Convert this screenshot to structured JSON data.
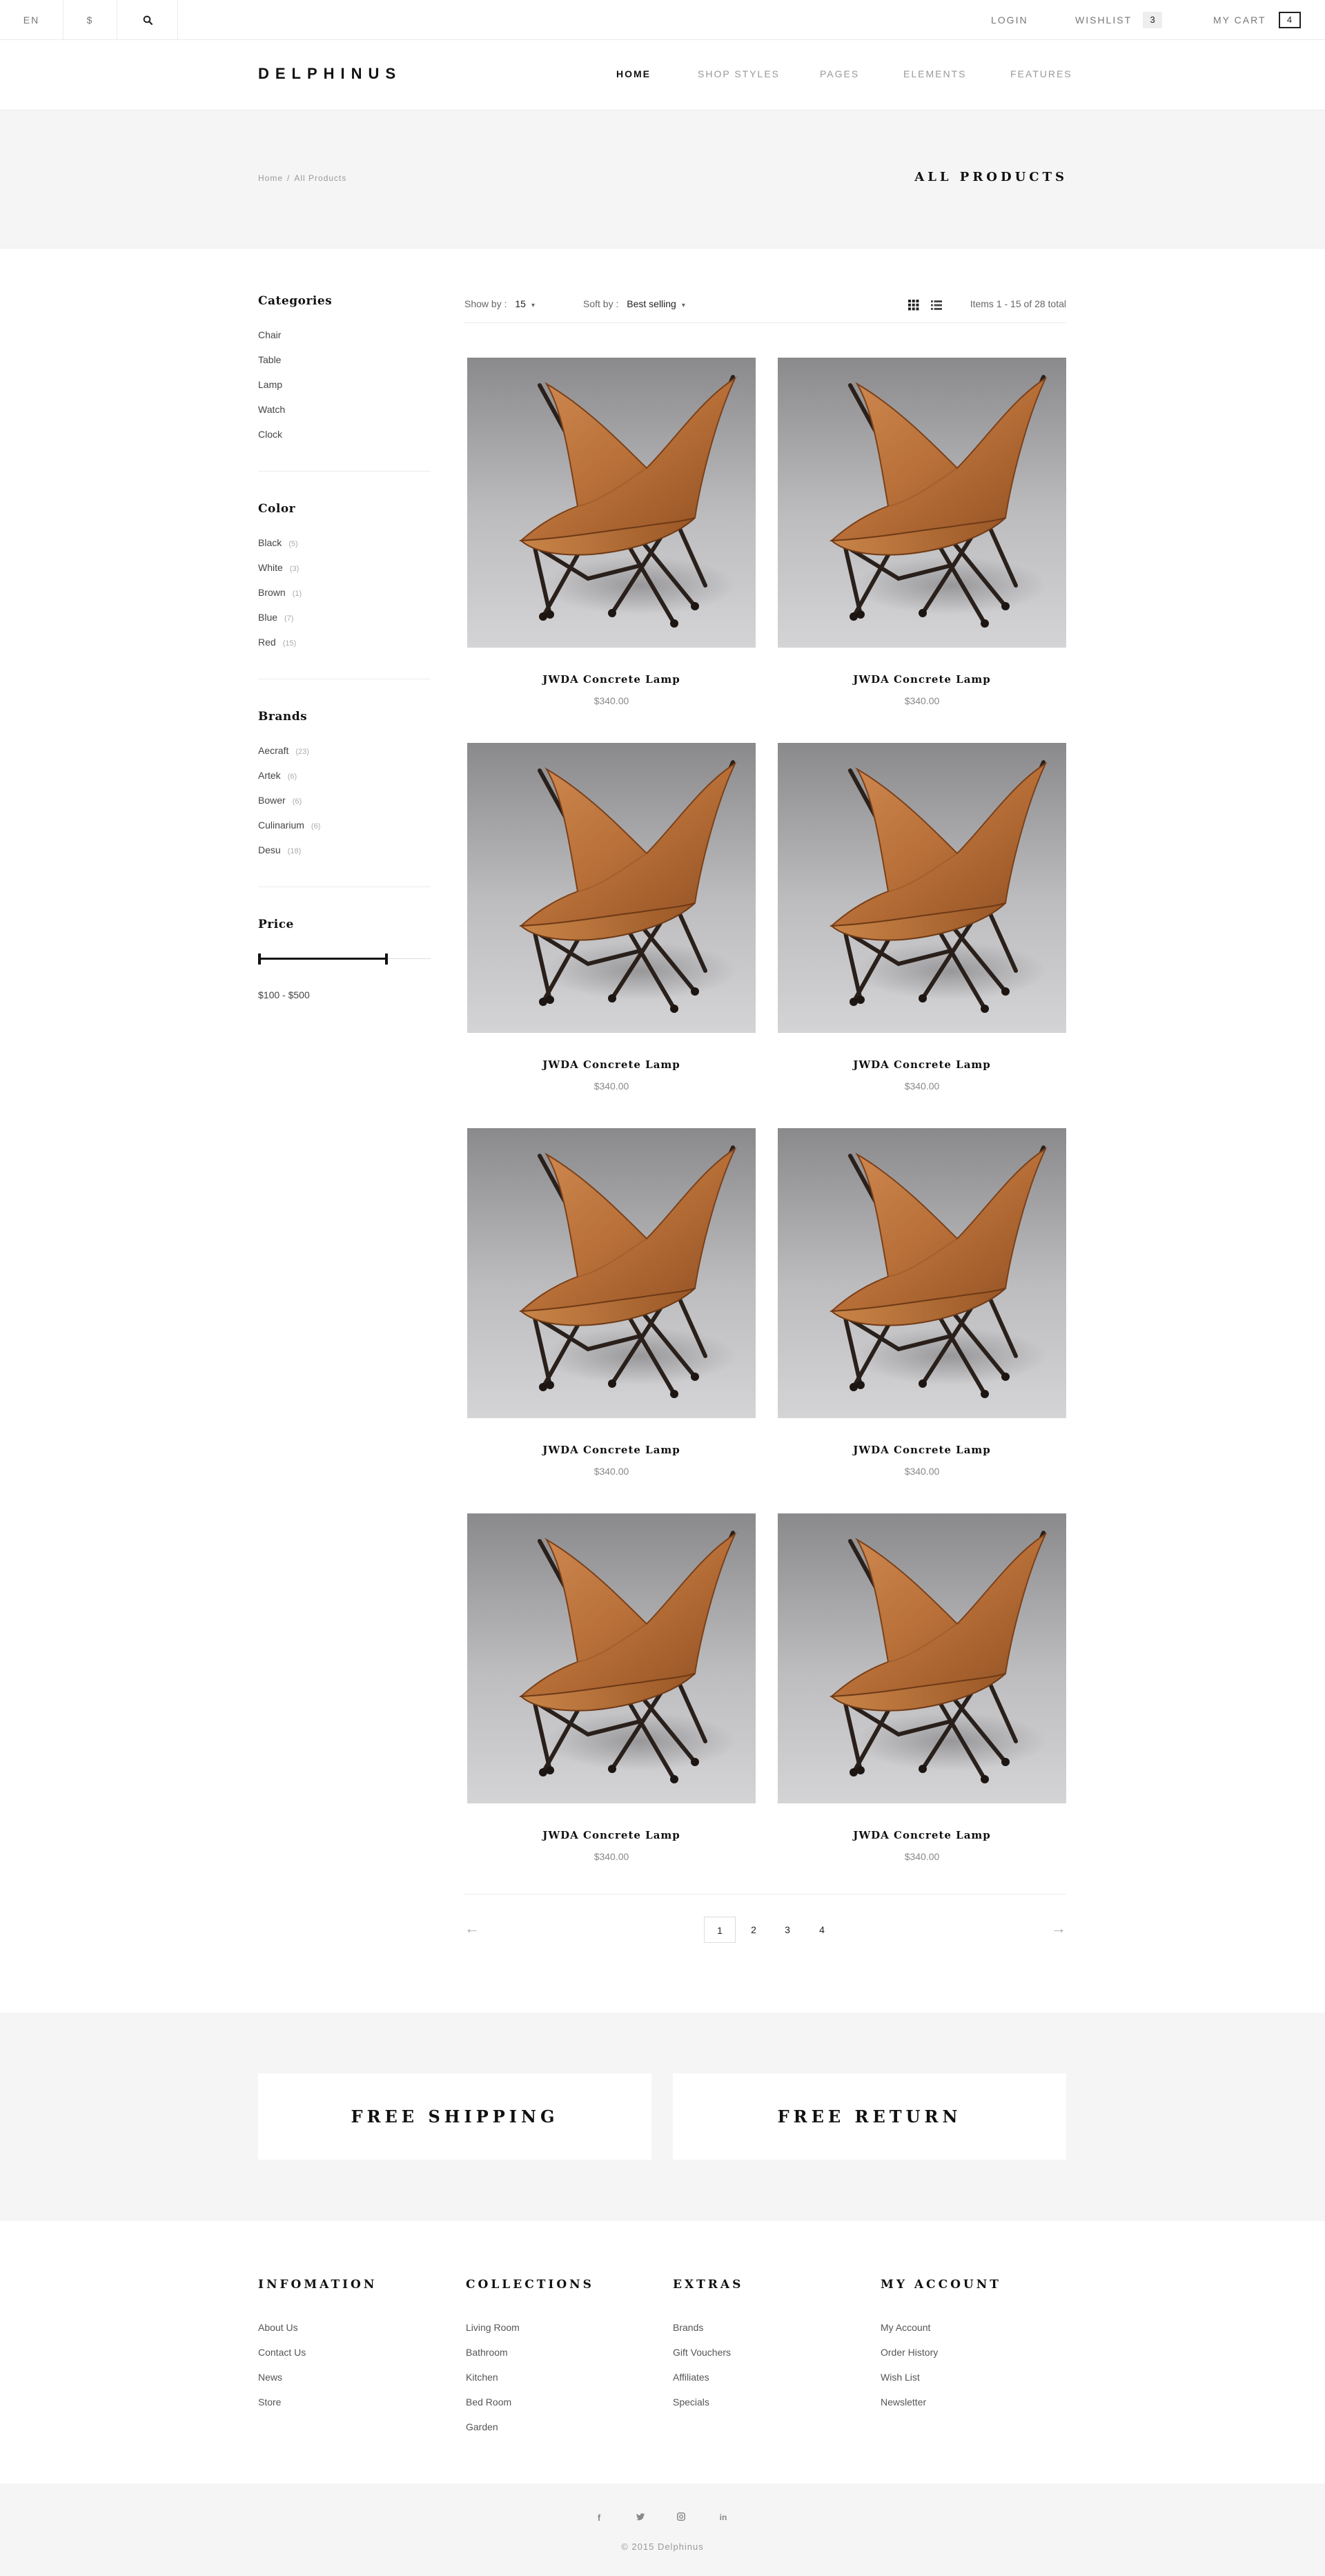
{
  "topbar": {
    "language": "EN",
    "currency": "$",
    "search_icon": "search-icon",
    "login": "LOGIN",
    "wishlist": "WISHLIST",
    "wishlist_count": "3",
    "cart": "MY CART",
    "cart_count": "4"
  },
  "header": {
    "logo": "DELPHINUS",
    "nav": [
      "HOME",
      "SHOP STYLES",
      "PAGES",
      "ELEMENTS",
      "FEATURES"
    ],
    "active_nav": "HOME"
  },
  "title_band": {
    "breadcrumb": [
      "Home",
      "All Products"
    ],
    "separator": "/",
    "title": "ALL PRODUCTS"
  },
  "sidebar": {
    "categories": {
      "title": "Categories",
      "items": [
        "Chair",
        "Table",
        "Lamp",
        "Watch",
        "Clock"
      ]
    },
    "color": {
      "title": "Color",
      "items": [
        {
          "label": "Black",
          "count": "(5)"
        },
        {
          "label": "White",
          "count": "(3)"
        },
        {
          "label": "Brown",
          "count": "(1)"
        },
        {
          "label": "Blue",
          "count": "(7)"
        },
        {
          "label": "Red",
          "count": "(15)"
        }
      ]
    },
    "brands": {
      "title": "Brands",
      "items": [
        {
          "label": "Aecraft",
          "count": "(23)"
        },
        {
          "label": "Artek",
          "count": "(6)"
        },
        {
          "label": "Bower",
          "count": "(6)"
        },
        {
          "label": "Culinarium",
          "count": "(6)"
        },
        {
          "label": "Desu",
          "count": "(18)"
        }
      ]
    },
    "price": {
      "title": "Price",
      "range_label": "$100 - $500"
    }
  },
  "toolbar": {
    "show_by_label": "Show by :",
    "show_by_value": "15",
    "sort_by_label": "Soft by :",
    "sort_by_value": "Best selling",
    "grid_icon": "grid-view-icon",
    "list_icon": "list-view-icon",
    "items_count": "Items 1 - 15 of 28 total"
  },
  "products": [
    {
      "name": "JWDA Concrete Lamp",
      "price": "$340.00"
    },
    {
      "name": "JWDA Concrete Lamp",
      "price": "$340.00"
    },
    {
      "name": "JWDA Concrete Lamp",
      "price": "$340.00"
    },
    {
      "name": "JWDA Concrete Lamp",
      "price": "$340.00"
    },
    {
      "name": "JWDA Concrete Lamp",
      "price": "$340.00"
    },
    {
      "name": "JWDA Concrete Lamp",
      "price": "$340.00"
    },
    {
      "name": "JWDA Concrete Lamp",
      "price": "$340.00"
    },
    {
      "name": "JWDA Concrete Lamp",
      "price": "$340.00"
    }
  ],
  "pagination": {
    "prev": "←",
    "next": "→",
    "pages": [
      "1",
      "2",
      "3",
      "4"
    ],
    "current": "1"
  },
  "features": [
    "FREE SHIPPING",
    "FREE RETURN"
  ],
  "footer": {
    "columns": [
      {
        "title": "INFOMATION",
        "links": [
          "About Us",
          "Contact Us",
          "News",
          "Store"
        ]
      },
      {
        "title": "COLLECTIONS",
        "links": [
          "Living Room",
          "Bathroom",
          "Kitchen",
          "Bed Room",
          "Garden"
        ]
      },
      {
        "title": "EXTRAS",
        "links": [
          "Brands",
          "Gift Vouchers",
          "Affiliates",
          "Specials"
        ]
      },
      {
        "title": "MY ACCOUNT",
        "links": [
          "My Account",
          "Order History",
          "Wish List",
          "Newsletter"
        ]
      }
    ]
  },
  "bottom": {
    "social": [
      {
        "icon": "facebook-icon",
        "glyph": "f"
      },
      {
        "icon": "twitter-icon",
        "glyph": "t"
      },
      {
        "icon": "instagram-icon",
        "glyph": "◻"
      },
      {
        "icon": "linkedin-icon",
        "glyph": "in"
      }
    ],
    "copyright": "© 2015 Delphinus"
  },
  "colors": {
    "background": "#ffffff",
    "band": "#f5f5f5",
    "text_dark": "#111111",
    "text_muted": "#999999",
    "chair_leather": "#b8703a"
  }
}
